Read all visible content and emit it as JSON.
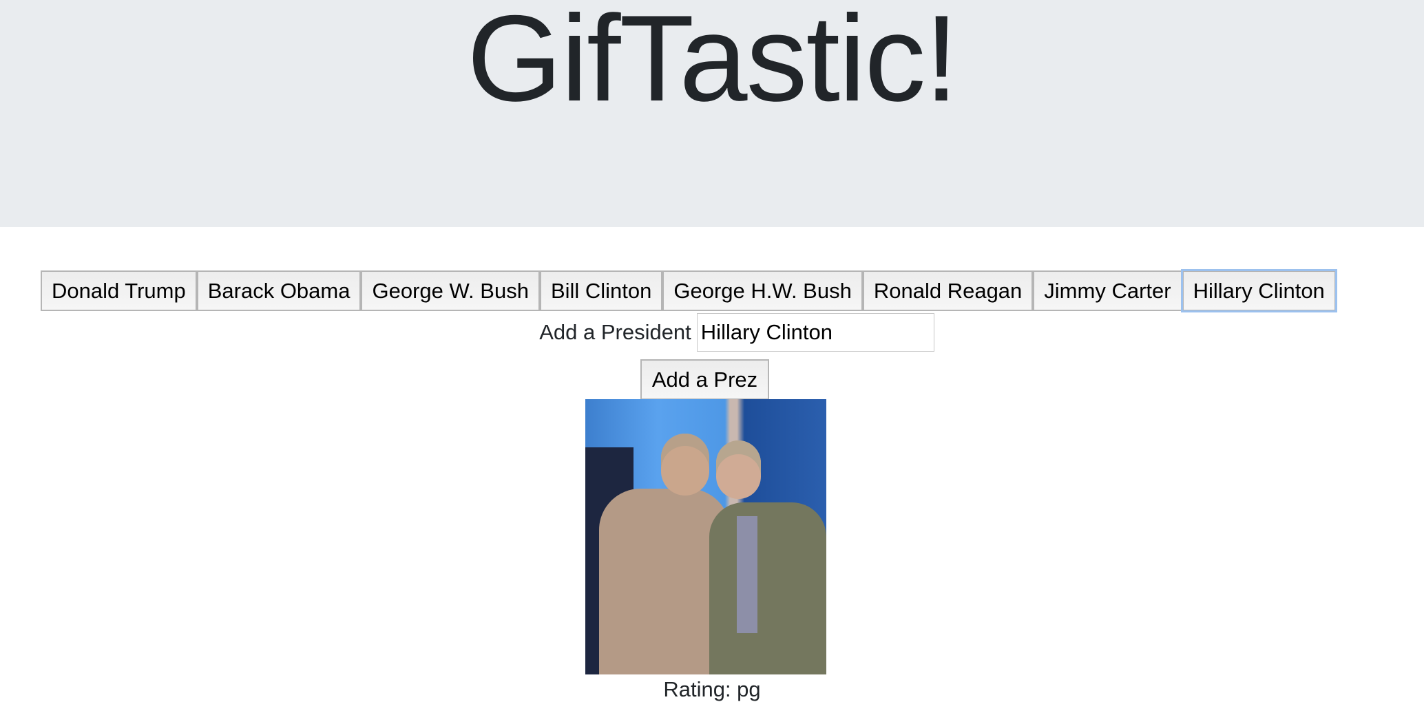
{
  "header": {
    "title": "GifTastic!"
  },
  "buttons": [
    "Donald Trump",
    "Barack Obama",
    "George W. Bush",
    "Bill Clinton",
    "George H.W. Bush",
    "Ronald Reagan",
    "Jimmy Carter",
    "Hillary Clinton"
  ],
  "form": {
    "label": "Add a President",
    "input_value": "Hillary Clinton",
    "submit_label": "Add a Prez"
  },
  "results": [
    {
      "rating_text": "Rating: pg",
      "image_desc": "gif"
    }
  ]
}
